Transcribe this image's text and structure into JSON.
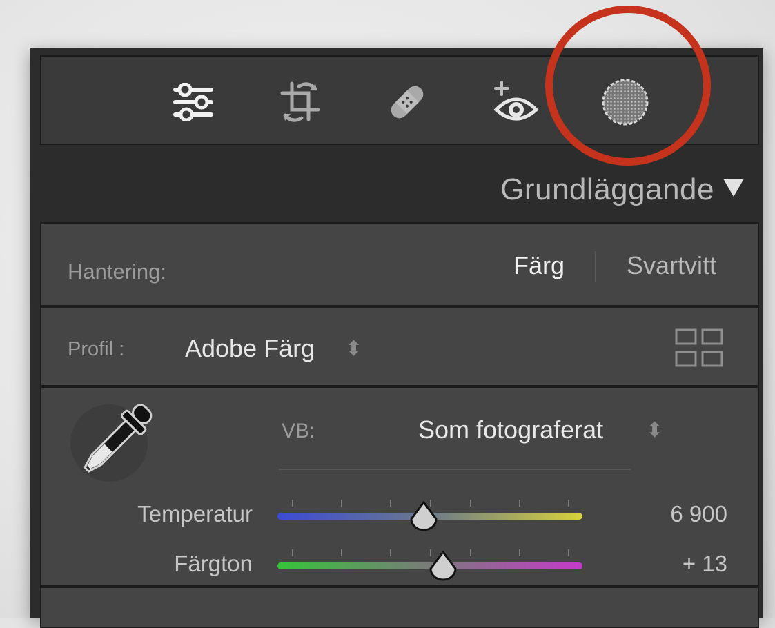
{
  "toolbar": {
    "tools": [
      {
        "icon": "edit-sliders-icon"
      },
      {
        "icon": "crop-rotate-icon"
      },
      {
        "icon": "healing-bandage-icon"
      },
      {
        "icon": "red-eye-icon"
      },
      {
        "icon": "masking-icon"
      }
    ],
    "highlight_color": "#c5331c"
  },
  "section": {
    "title": "Grundläggande",
    "arrow": "▼"
  },
  "treatment": {
    "label": "Hantering:",
    "options": [
      "Färg",
      "Svartvitt"
    ],
    "selected": "Färg"
  },
  "profile": {
    "label": "Profil :",
    "value": "Adobe Färg",
    "stepper": "⬍"
  },
  "white_balance": {
    "label": "VB:",
    "value": "Som fotograferat",
    "stepper": "⬍"
  },
  "sliders": [
    {
      "label": "Temperatur",
      "value": "6 900",
      "position": 0.495
    },
    {
      "label": "Färgton",
      "value": "+ 13",
      "position": 0.545
    }
  ]
}
